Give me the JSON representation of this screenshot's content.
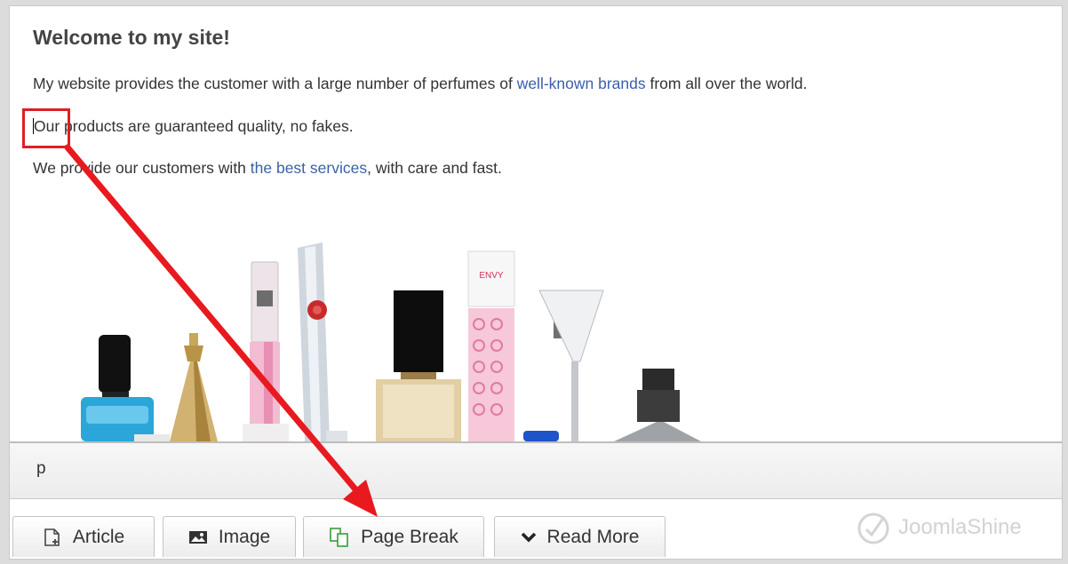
{
  "content": {
    "heading": "Welcome to my site!",
    "p1": {
      "before": "My website provides the customer with a large number of perfumes of ",
      "link": "well-known brands",
      "after": " from all over the world."
    },
    "p2": {
      "highlighted": "Our",
      "rest": " products are guaranteed quality, no fakes."
    },
    "p3": {
      "before": "We provide our customers with ",
      "link": "the best services",
      "after": ", with care and fast."
    },
    "image_label": "ENVY"
  },
  "statusbar": {
    "path": "p"
  },
  "buttons": {
    "article": {
      "label": "Article",
      "icon": "article-icon"
    },
    "image": {
      "label": "Image",
      "icon": "image-icon"
    },
    "pagebreak": {
      "label": "Page Break",
      "icon": "pagebreak-icon"
    },
    "readmore": {
      "label": "Read More",
      "icon": "chevron-down-icon"
    }
  },
  "watermark": {
    "text": "JoomlaShine"
  },
  "colors": {
    "link": "#3b5fa8",
    "highlight": "#dd1f26",
    "arrow": "#e8191f"
  }
}
